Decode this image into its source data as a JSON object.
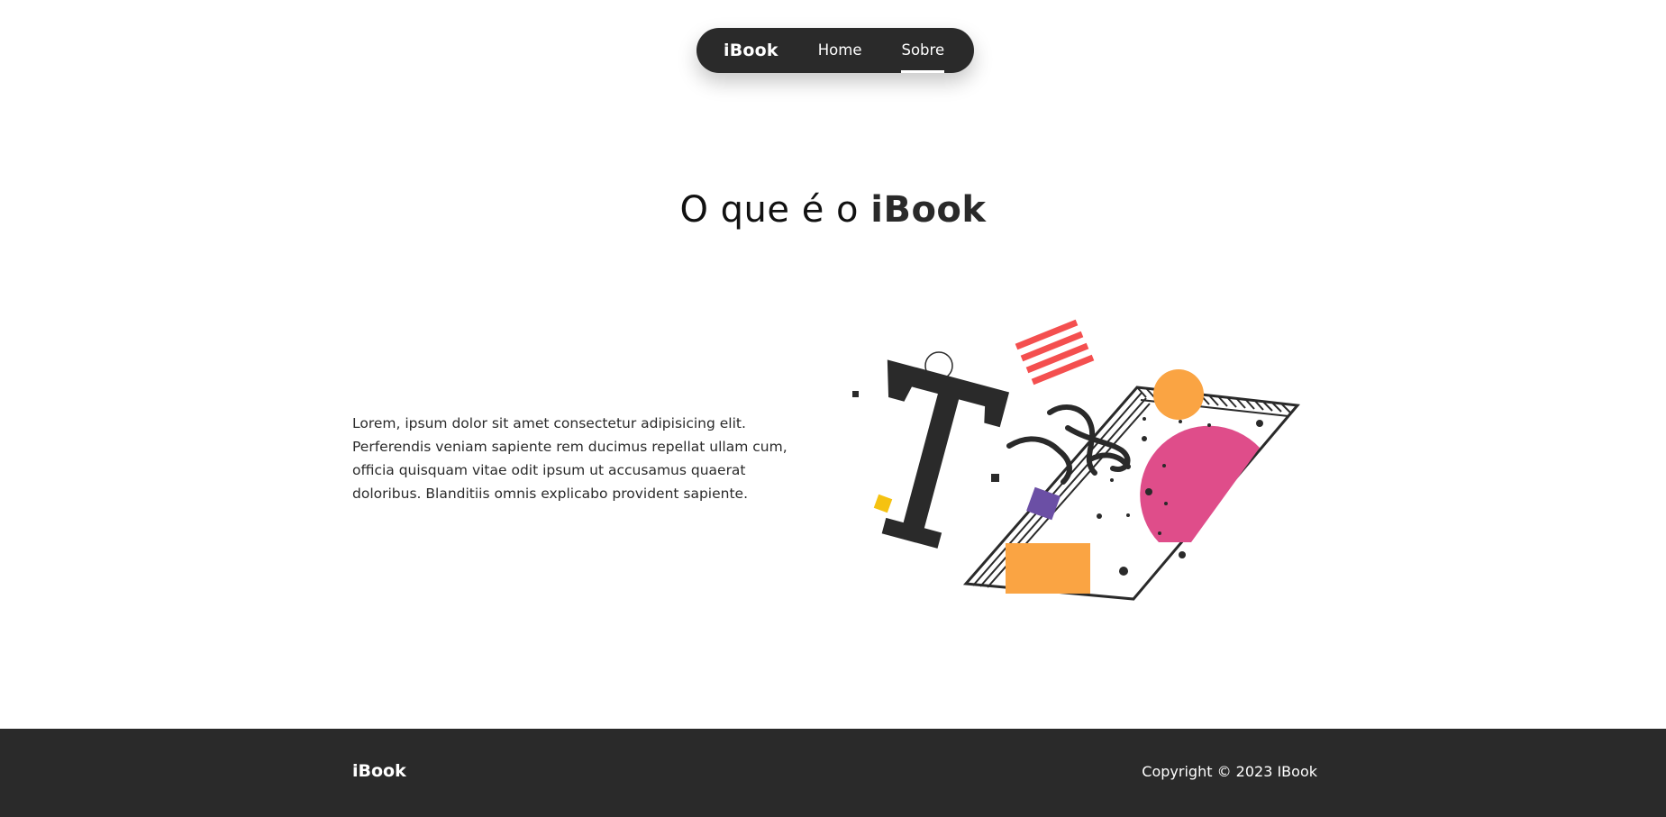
{
  "nav": {
    "logo": "iBook",
    "items": [
      {
        "label": "Home"
      },
      {
        "label": "Sobre"
      }
    ],
    "active": "Sobre"
  },
  "main": {
    "title_prefix": "O que é o ",
    "title_brand": "iBook",
    "text": "Lorem, ipsum dolor sit amet consectetur adipisicing elit. Perferendis veniam sapiente rem ducimus repellat ullam cum, officia quisquam vitae odit ipsum ut accusamus quaerat doloribus. Blanditiis omnis explicabo provident sapiente.",
    "illustration": {
      "icon": "book-typography-illustration",
      "colors": {
        "dark": "#2a2a2a",
        "orange": "#faa443",
        "pink": "#df4d8a",
        "red": "#f44f4f",
        "purple": "#6b4fa5",
        "yellow": "#f5c211"
      }
    }
  },
  "footer": {
    "logo": "iBook",
    "copyright": "Copyright © 2023 IBook"
  }
}
